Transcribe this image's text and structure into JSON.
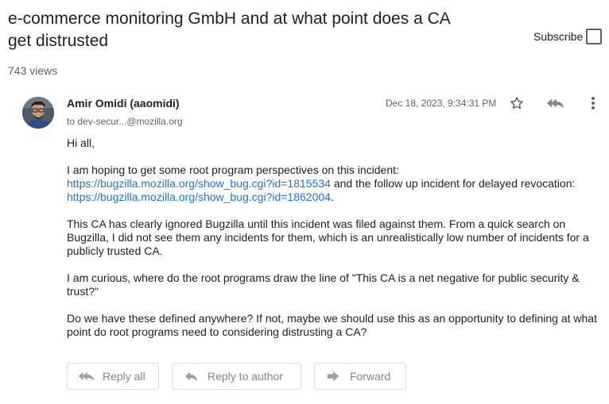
{
  "thread": {
    "title": "e-commerce monitoring GmbH and at what point does a CA get distrusted",
    "subscribe_label": "Subscribe",
    "views": "743 views"
  },
  "message": {
    "author": "Amir Omidi (aaomidi)",
    "recipient": "to dev-secur...@mozilla.org",
    "timestamp": "Dec 18, 2023, 9:34:31 PM",
    "greeting": "Hi all,",
    "p1_before": "I am hoping to get some root program perspectives on this incident: ",
    "p1_link1": "https://bugzilla.mozilla.org/show_bug.cgi?id=1815534",
    "p1_middle": " and the follow up incident for delayed revocation: ",
    "p1_link2": "https://bugzilla.mozilla.org/show_bug.cgi?id=1862004",
    "p1_end": ".",
    "p2": "This CA has clearly ignored Bugzilla until this incident was filed against them. From a quick search on Bugzilla, I did not see them any incidents for them, which is an unrealistically low number of incidents for a publicly trusted CA.",
    "p3": "I am curious, where do the root programs draw the line of \"This CA is a net negative for public security & trust?\"",
    "p4": "Do we have these defined anywhere? If not, maybe we should use this as an opportunity to defining at what point do root programs need to considering distrusting a CA?"
  },
  "actions": {
    "reply_all": "Reply all",
    "reply_author": "Reply to author",
    "forward": "Forward"
  },
  "icons": {
    "star": "star-outline-icon",
    "reply_all": "reply-all-icon",
    "more": "more-vert-icon",
    "reply": "reply-icon",
    "forward": "forward-icon"
  },
  "colors": {
    "link": "#1a73e8",
    "muted": "#5f6368",
    "text": "#202124",
    "border": "#dadce0"
  }
}
